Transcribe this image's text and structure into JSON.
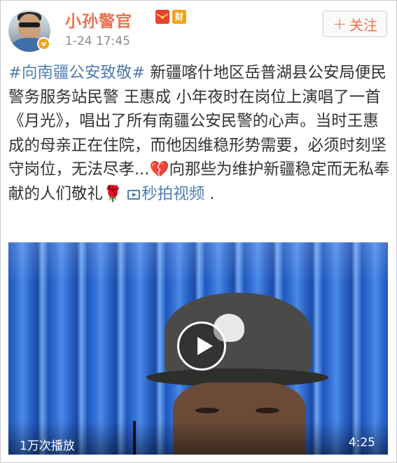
{
  "post": {
    "username": "小孙警官",
    "timestamp": "1-24 17:45",
    "badges": [
      "red-envelope-icon",
      "wealth-badge-icon"
    ],
    "wealth_badge_label": "财",
    "verified_label": "v",
    "follow_label": "关注",
    "follow_plus": "+",
    "text": {
      "hashtag": "#向南疆公安致敬#",
      "body_1": " 新疆喀什地区岳普湖县公安局便民警务服务站民警 王惠成 小年夜时在岗位上演唱了一首《月光》，唱出了所有南疆公安民警的心声。当时王惠成的母亲正在住院，而他因维稳形势需要，必须时刻坚守岗位，无法尽孝...",
      "broken_heart": "💔",
      "body_2": "向那些为维护新疆稳定而无私奉献的人们敬礼",
      "rose": "🌹",
      "video_link_label": "秒拍视频",
      "tail": " ."
    }
  },
  "video": {
    "play_count": "1万次播放",
    "duration": "4:25"
  },
  "colors": {
    "username": "#eb7350",
    "link": "#507daf",
    "text": "#333333",
    "timestamp": "#8b8b8b"
  }
}
